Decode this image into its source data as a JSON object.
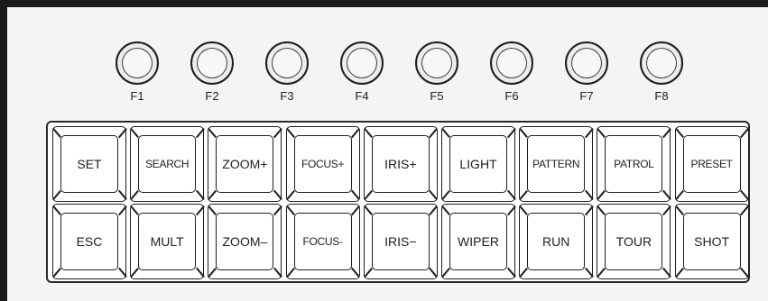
{
  "function_keys": [
    "F1",
    "F2",
    "F3",
    "F4",
    "F5",
    "F6",
    "F7",
    "F8"
  ],
  "keypad": {
    "rows": [
      [
        "SET",
        "SEARCH",
        "ZOOM+",
        "FOCUS+",
        "IRIS+",
        "LIGHT",
        "PATTERN",
        "PATROL",
        "PRESET"
      ],
      [
        "ESC",
        "MULT",
        "ZOOM–",
        "FOCUS-",
        "IRIS−",
        "WIPER",
        "RUN",
        "TOUR",
        "SHOT"
      ]
    ]
  }
}
